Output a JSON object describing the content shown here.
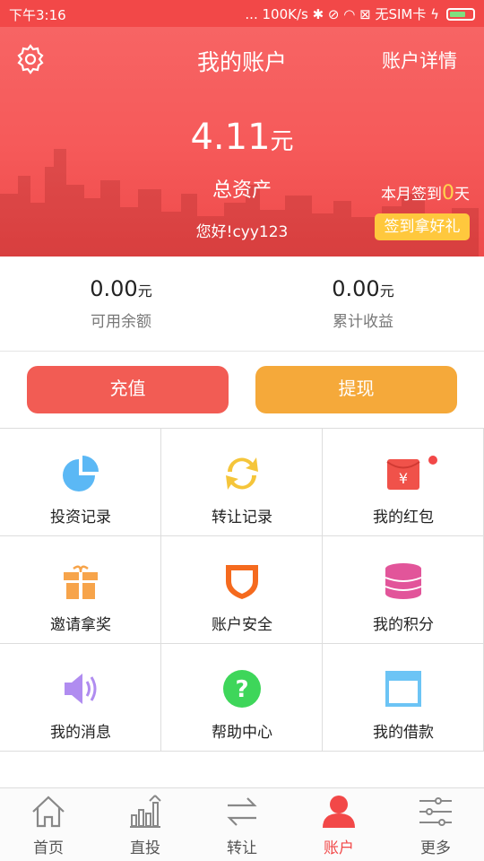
{
  "status_bar": {
    "time": "下午3:16",
    "right": "... 100K/s ✱ ⊘ ◠ ⊠ 无SIM卡 ϟ"
  },
  "header": {
    "title": "我的账户",
    "detail_link": "账户详情",
    "total_amount": "4.11",
    "total_unit": "元",
    "total_label": "总资产",
    "greeting": "您好!cyy123",
    "signin_prefix": "本月签到",
    "signin_days": "0",
    "signin_suffix": "天",
    "signin_button": "签到拿好礼"
  },
  "stats": [
    {
      "value": "0.00",
      "unit": "元",
      "label": "可用余额"
    },
    {
      "value": "0.00",
      "unit": "元",
      "label": "累计收益"
    }
  ],
  "actions": {
    "recharge": "充值",
    "withdraw": "提现"
  },
  "grid": [
    {
      "label": "投资记录",
      "icon": "pie-chart-icon"
    },
    {
      "label": "转让记录",
      "icon": "transfer-arrows-icon"
    },
    {
      "label": "我的红包",
      "icon": "red-envelope-icon"
    },
    {
      "label": "邀请拿奖",
      "icon": "gift-icon"
    },
    {
      "label": "账户安全",
      "icon": "shield-icon"
    },
    {
      "label": "我的积分",
      "icon": "database-icon"
    },
    {
      "label": "我的消息",
      "icon": "speaker-icon"
    },
    {
      "label": "帮助中心",
      "icon": "question-icon"
    },
    {
      "label": "我的借款",
      "icon": "card-icon"
    }
  ],
  "tabbar": [
    {
      "label": "首页",
      "icon": "home-icon",
      "active": false
    },
    {
      "label": "直投",
      "icon": "bar-chart-icon",
      "active": false
    },
    {
      "label": "转让",
      "icon": "exchange-icon",
      "active": false
    },
    {
      "label": "账户",
      "icon": "user-icon",
      "active": true
    },
    {
      "label": "更多",
      "icon": "sliders-icon",
      "active": false
    }
  ],
  "colors": {
    "brand_red": "#f24848",
    "recharge": "#f25c54",
    "withdraw": "#f5a93a",
    "signin_button": "#ffc83d"
  }
}
